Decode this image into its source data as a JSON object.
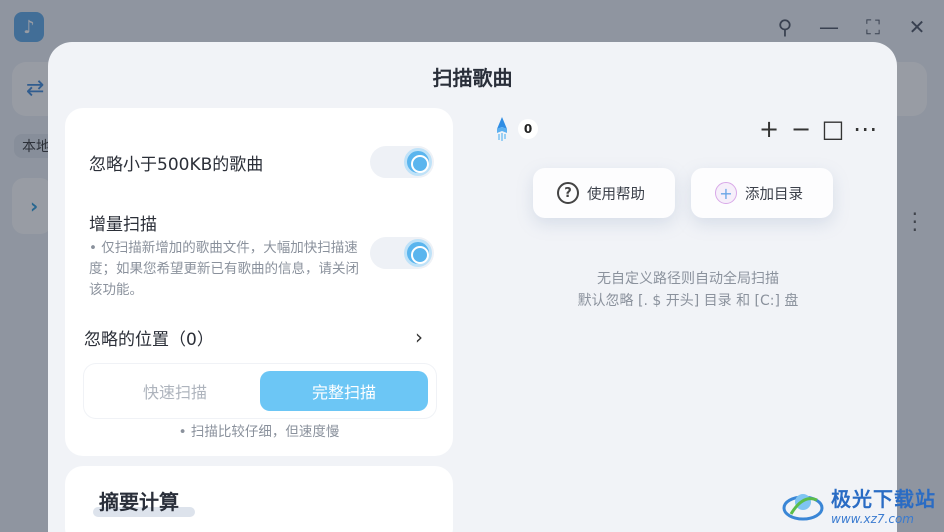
{
  "background": {
    "logo_glyph": "♪",
    "window_controls": [
      "⚲",
      "—",
      "⛶",
      "✕"
    ],
    "toolbar_arrow": "⇄",
    "tag_label": "本地"
  },
  "modal": {
    "title": "扫描歌曲",
    "ignore_small": {
      "label": "忽略小于500KB的歌曲",
      "enabled": true
    },
    "incremental": {
      "label": "增量扫描",
      "description": "• 仅扫描新增加的歌曲文件，大幅加快扫描速度；如果您希望更新已有歌曲的信息，请关闭该功能。",
      "enabled": true
    },
    "ignored_locations": {
      "label": "忽略的位置（0）"
    },
    "scan_mode": {
      "options": [
        "快速扫描",
        "完整扫描"
      ],
      "selected": "完整扫描",
      "hint": "• 扫描比较仔细，但速度慢"
    },
    "summary_title": "摘要计算",
    "folder_count": "0",
    "tools": [
      "+",
      "−",
      "□",
      "⋯"
    ],
    "help_button": "使用帮助",
    "add_folder_button": "添加目录",
    "empty_line1": "无自定义路径则自动全局扫描",
    "empty_line2": "默认忽略 [. $ 开头] 目录 和 [C:] 盘"
  },
  "watermark": {
    "name": "极光下载站",
    "url": "www.xz7.com"
  },
  "colors": {
    "accent": "#6cc6f5",
    "toggle_knob": "#5ab5ee",
    "title_highlight": "#c9d6e6"
  }
}
